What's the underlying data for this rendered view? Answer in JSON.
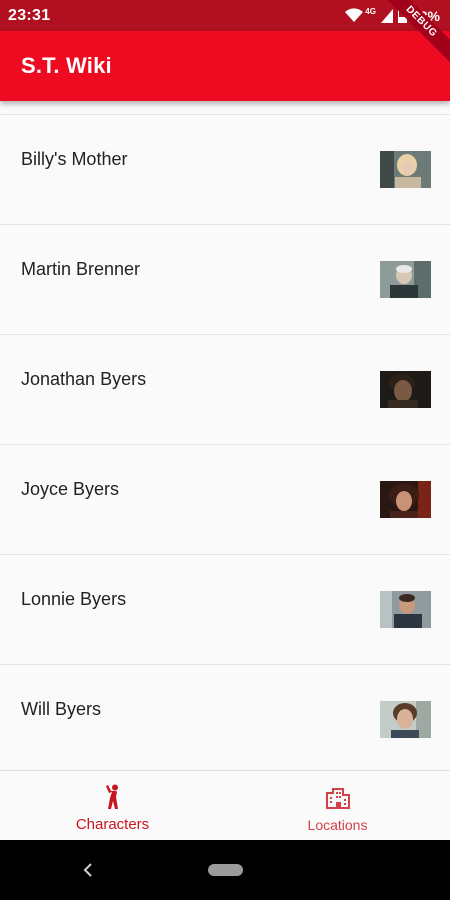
{
  "status_bar": {
    "time": "23:31",
    "network": "4G",
    "battery": "33%",
    "icons": [
      "wifi-icon",
      "signal-icon",
      "battery-icon"
    ]
  },
  "app_bar": {
    "title": "S.T. Wiki",
    "debug_banner": "DEBUG"
  },
  "colors": {
    "status_bar": "#b0101f",
    "app_bar": "#ee0b22",
    "accent": "#c9151f",
    "list_background": "#fafafa",
    "divider": "#e3e3e3"
  },
  "characters": [
    {
      "name": "Billy's Mother"
    },
    {
      "name": "Martin Brenner"
    },
    {
      "name": "Jonathan Byers"
    },
    {
      "name": "Joyce Byers"
    },
    {
      "name": "Lonnie Byers"
    },
    {
      "name": "Will Byers"
    }
  ],
  "bottom_nav": {
    "items": [
      {
        "label": "Characters",
        "icon": "person-icon",
        "selected": true
      },
      {
        "label": "Locations",
        "icon": "city-icon",
        "selected": false
      }
    ]
  },
  "system_nav": {
    "icons": [
      "back-icon",
      "home-pill"
    ]
  }
}
